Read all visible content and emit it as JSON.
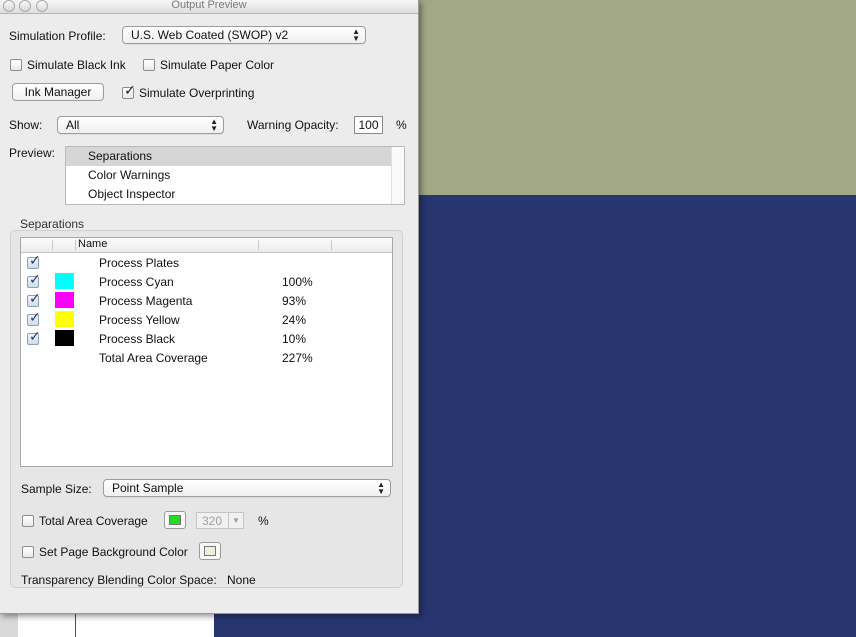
{
  "window": {
    "title": "Output Preview"
  },
  "simulation_profile": {
    "label": "Simulation Profile:",
    "value": "U.S. Web Coated (SWOP) v2"
  },
  "simulate_black_ink": {
    "label": "Simulate Black Ink",
    "checked": false
  },
  "simulate_paper_color": {
    "label": "Simulate Paper Color",
    "checked": false
  },
  "ink_manager": {
    "label": "Ink Manager"
  },
  "simulate_overprinting": {
    "label": "Simulate Overprinting",
    "checked": true
  },
  "show": {
    "label": "Show:",
    "value": "All"
  },
  "warning_opacity": {
    "label": "Warning Opacity:",
    "value": "100",
    "unit": "%"
  },
  "preview": {
    "label": "Preview:",
    "items": [
      "Separations",
      "Color Warnings",
      "Object Inspector"
    ],
    "selected": "Separations"
  },
  "separations": {
    "group_label": "Separations",
    "columns": [
      "",
      "",
      "Name",
      "",
      ""
    ],
    "rows": [
      {
        "checked": true,
        "swatch": null,
        "name": "Process Plates",
        "value": ""
      },
      {
        "checked": true,
        "swatch": "#00ffff",
        "name": "Process Cyan",
        "value": "100%"
      },
      {
        "checked": true,
        "swatch": "#ff00ff",
        "name": "Process Magenta",
        "value": "93%"
      },
      {
        "checked": true,
        "swatch": "#ffff00",
        "name": "Process Yellow",
        "value": "24%"
      },
      {
        "checked": true,
        "swatch": "#000000",
        "name": "Process Black",
        "value": "10%"
      },
      {
        "checked": null,
        "swatch": null,
        "name": "Total Area Coverage",
        "value": "227%"
      }
    ]
  },
  "sample_size": {
    "label": "Sample Size:",
    "value": "Point Sample"
  },
  "total_area_coverage": {
    "label": "Total Area Coverage",
    "checked": false,
    "color": "#22dd22",
    "value": "320",
    "unit": "%"
  },
  "page_background": {
    "label": "Set Page Background Color",
    "checked": false,
    "color": "#f0efd9"
  },
  "transparency_blending": {
    "label": "Transparency Blending Color Space:",
    "value": "None"
  },
  "colors": {
    "canvas_top": "#a2a884",
    "canvas_bottom": "#283670",
    "panel": "#ececec"
  }
}
